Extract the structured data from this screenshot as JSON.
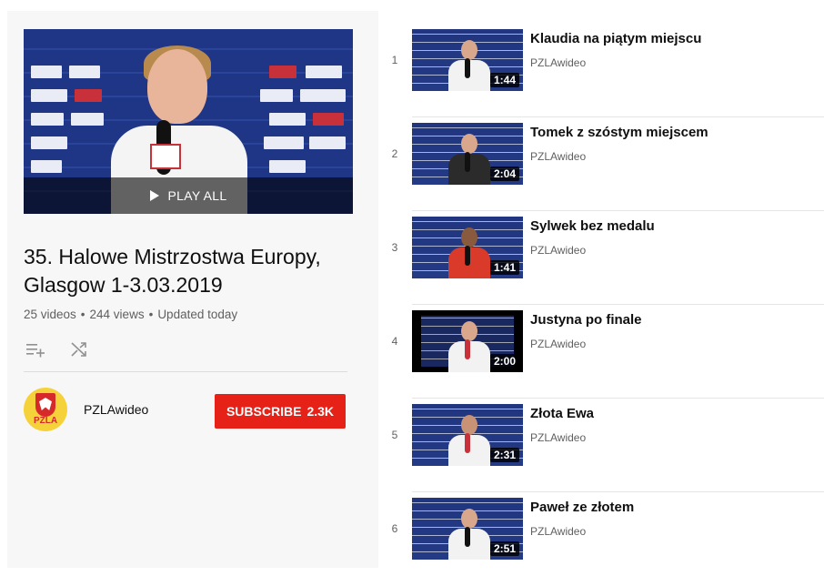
{
  "hero": {
    "play_all_label": "PLAY ALL"
  },
  "playlist": {
    "title": "35. Halowe Mistrzostwa Europy, Glasgow 1-3.03.2019",
    "video_count": "25 videos",
    "views": "244 views",
    "updated": "Updated today",
    "separator": "•"
  },
  "actions": {
    "icons": [
      "add-to-queue-icon",
      "shuffle-icon"
    ]
  },
  "channel": {
    "name": "PZLAwideo",
    "avatar_text": "PZLA",
    "subscribe_label": "SUBSCRIBE",
    "subscriber_count": "2.3K"
  },
  "colors": {
    "subscribe": "#e62117",
    "text": "#0f0f0f",
    "muted": "#606060"
  },
  "videos": [
    {
      "index": "1",
      "title": "Klaudia na piątym miejscu",
      "channel": "PZLAwideo",
      "duration": "1:44"
    },
    {
      "index": "2",
      "title": "Tomek z szóstym miejscem",
      "channel": "PZLAwideo",
      "duration": "2:04"
    },
    {
      "index": "3",
      "title": "Sylwek bez medalu",
      "channel": "PZLAwideo",
      "duration": "1:41"
    },
    {
      "index": "4",
      "title": "Justyna po finale",
      "channel": "PZLAwideo",
      "duration": "2:00"
    },
    {
      "index": "5",
      "title": "Złota Ewa",
      "channel": "PZLAwideo",
      "duration": "2:31"
    },
    {
      "index": "6",
      "title": "Paweł ze złotem",
      "channel": "PZLAwideo",
      "duration": "2:51"
    }
  ]
}
